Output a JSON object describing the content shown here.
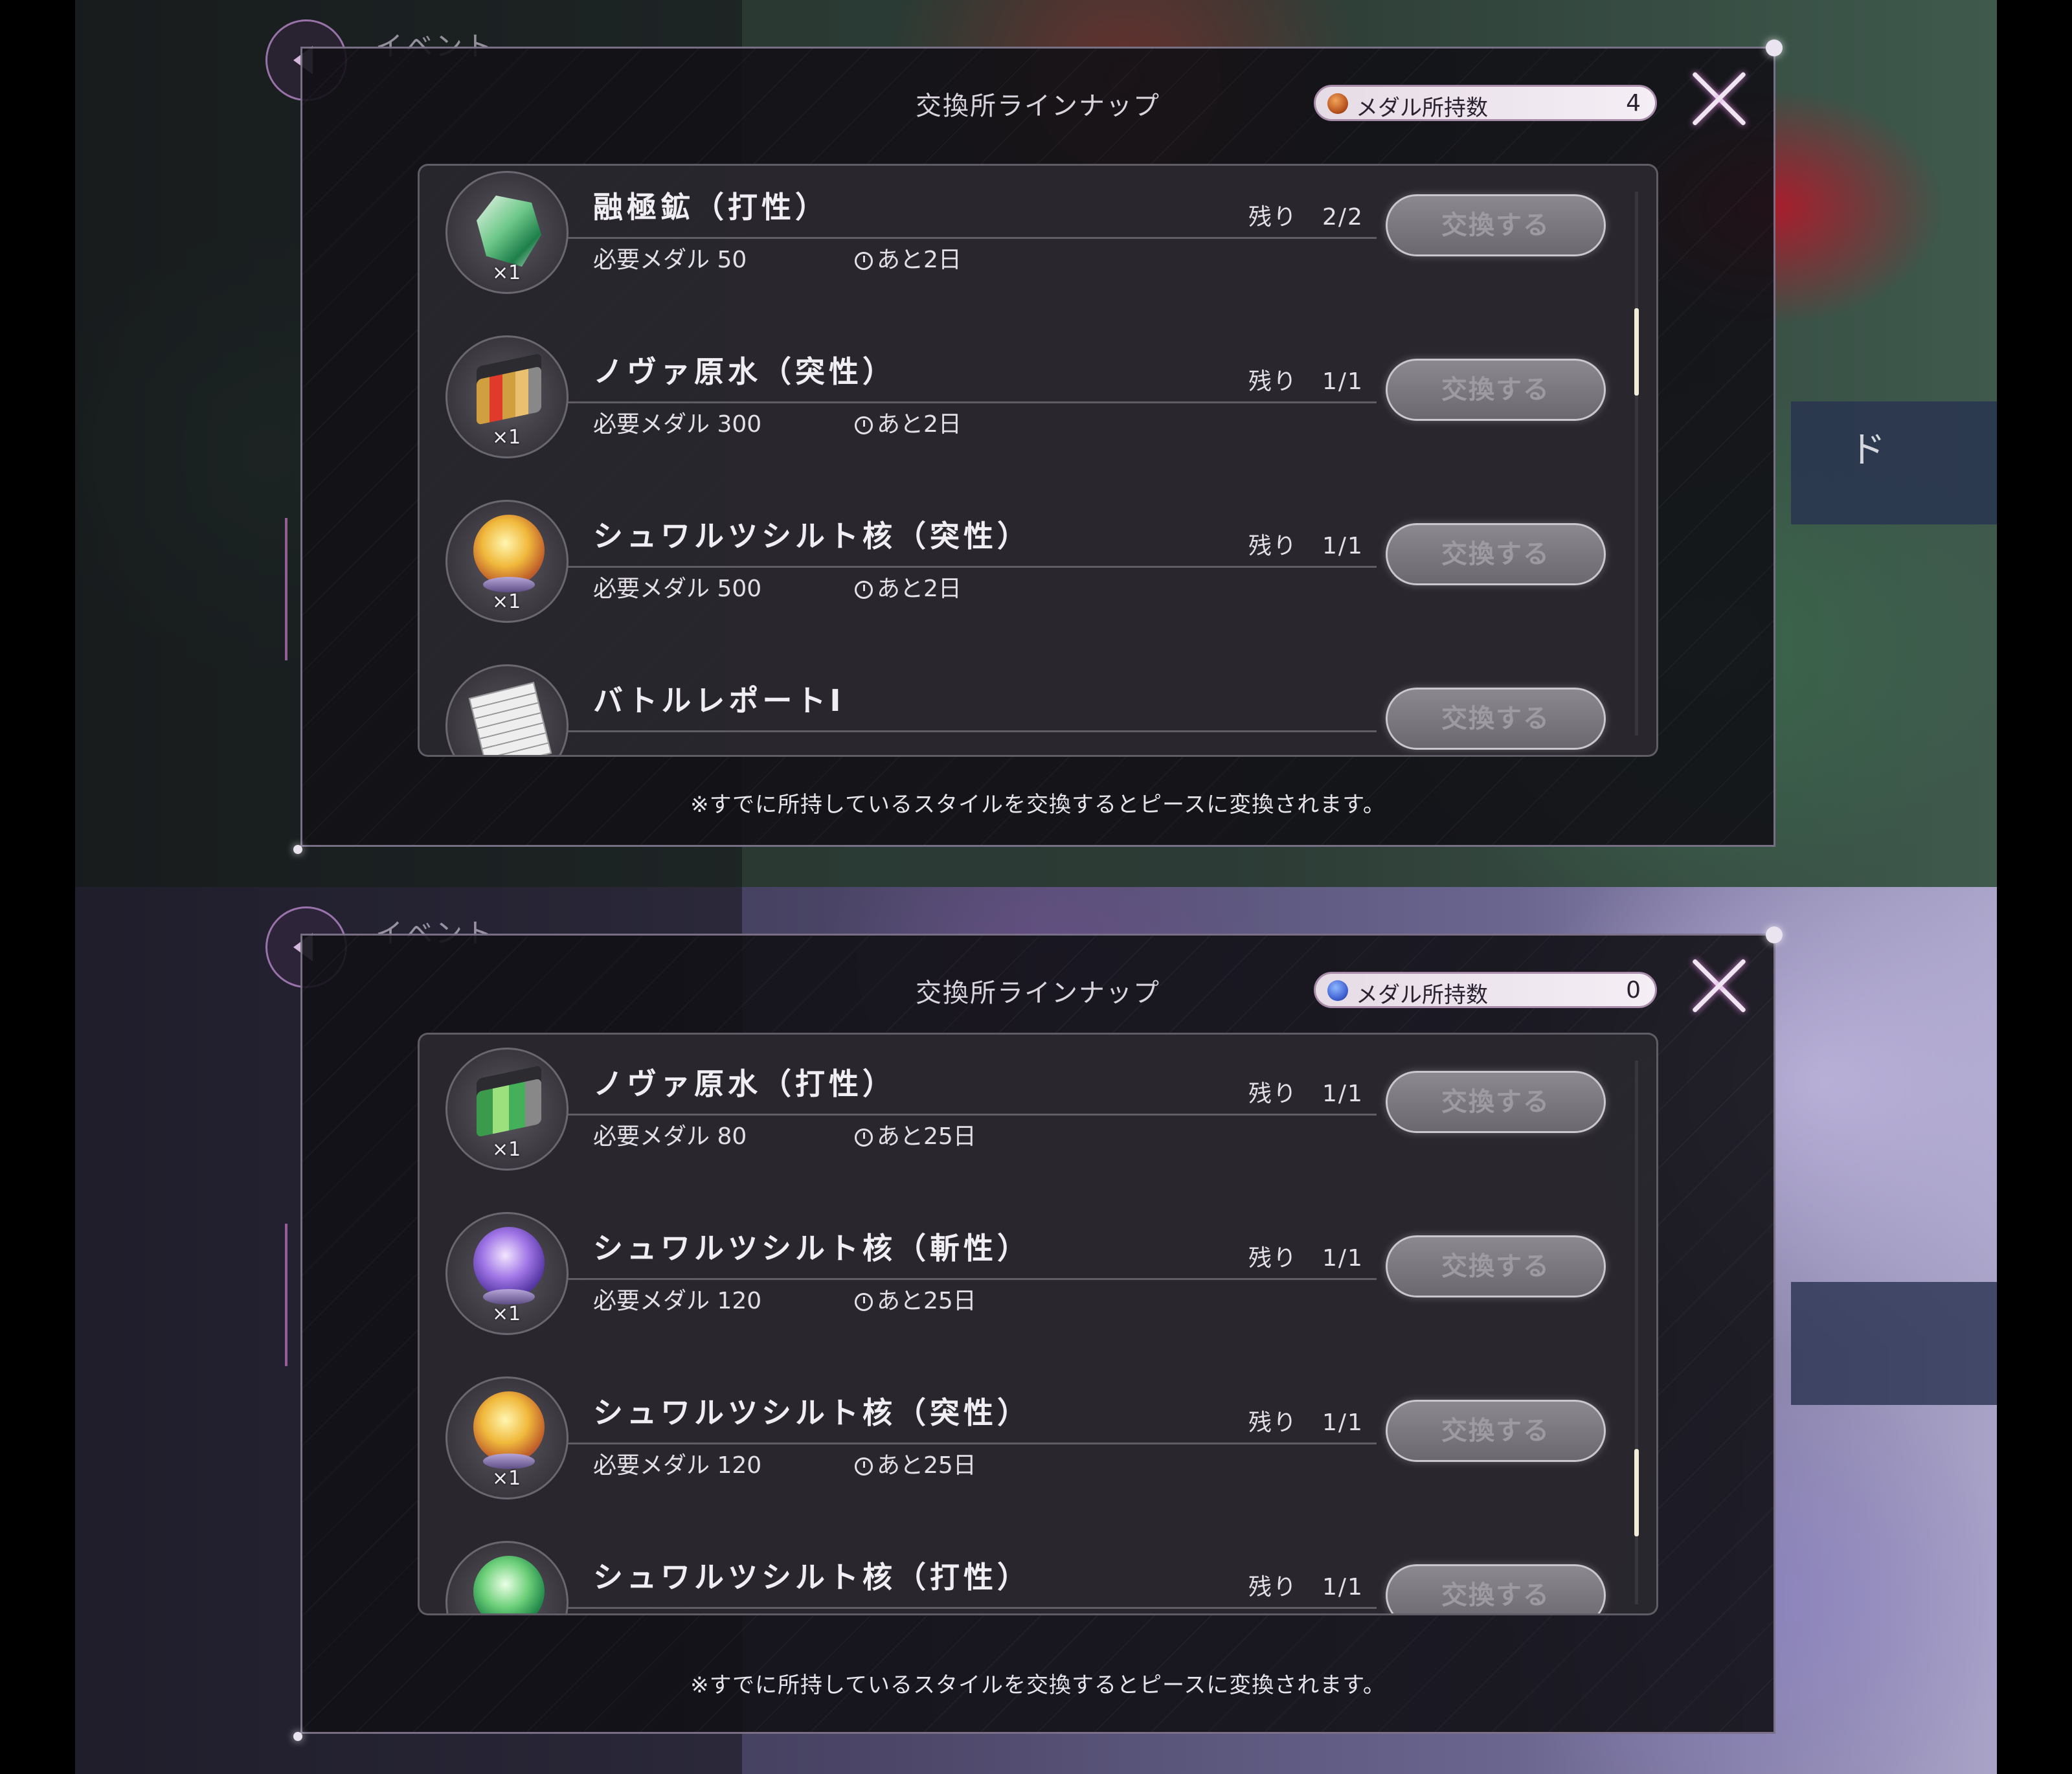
{
  "screens": [
    {
      "dialog_title": "交換所ラインナップ",
      "medal_label": "メダル所持数",
      "medal_count": "4",
      "medal_color": "#c8641e",
      "back_label": "イベント",
      "items": [
        {
          "name": "融極鉱（打性）",
          "quantity": "×1",
          "cost": "必要メダル 50",
          "time_left": "あと2日",
          "remaining": "残り　2/2",
          "button": "交換する",
          "icon": "ore-crystal-icon"
        },
        {
          "name": "ノヴァ原水（突性）",
          "quantity": "×1",
          "cost": "必要メダル 300",
          "time_left": "あと2日",
          "remaining": "残り　1/1",
          "button": "交換する",
          "icon": "vial-case-icon"
        },
        {
          "name": "シュワルツシルト核（突性）",
          "quantity": "×1",
          "cost": "必要メダル 500",
          "time_left": "あと2日",
          "remaining": "残り　1/1",
          "button": "交換する",
          "icon": "yellow-orb-icon"
        },
        {
          "name": "バトルレポートⅠ",
          "quantity": "",
          "cost": "",
          "time_left": "",
          "remaining": "",
          "button": "交換する",
          "icon": "battle-report-icon"
        }
      ],
      "note": "※すでに所持しているスタイルを交換するとピースに変換されます。"
    },
    {
      "dialog_title": "交換所ラインナップ",
      "medal_label": "メダル所持数",
      "medal_count": "0",
      "medal_color": "#3d5fd0",
      "back_label": "イベント",
      "items": [
        {
          "name": "ノヴァ原水（打性）",
          "quantity": "×1",
          "cost": "必要メダル 80",
          "time_left": "あと25日",
          "remaining": "残り　1/1",
          "button": "交換する",
          "icon": "vial-case-icon"
        },
        {
          "name": "シュワルツシルト核（斬性）",
          "quantity": "×1",
          "cost": "必要メダル 120",
          "time_left": "あと25日",
          "remaining": "残り　1/1",
          "button": "交換する",
          "icon": "purple-orb-icon"
        },
        {
          "name": "シュワルツシルト核（突性）",
          "quantity": "×1",
          "cost": "必要メダル 120",
          "time_left": "あと25日",
          "remaining": "残り　1/1",
          "button": "交換する",
          "icon": "yellow-orb-icon"
        },
        {
          "name": "シュワルツシルト核（打性）",
          "quantity": "",
          "cost": "",
          "time_left": "",
          "remaining": "残り　1/1",
          "button": "交換する",
          "icon": "green-orb-icon"
        }
      ],
      "note": "※すでに所持しているスタイルを交換するとピースに変換されます。"
    }
  ],
  "background_glyph": "ド"
}
